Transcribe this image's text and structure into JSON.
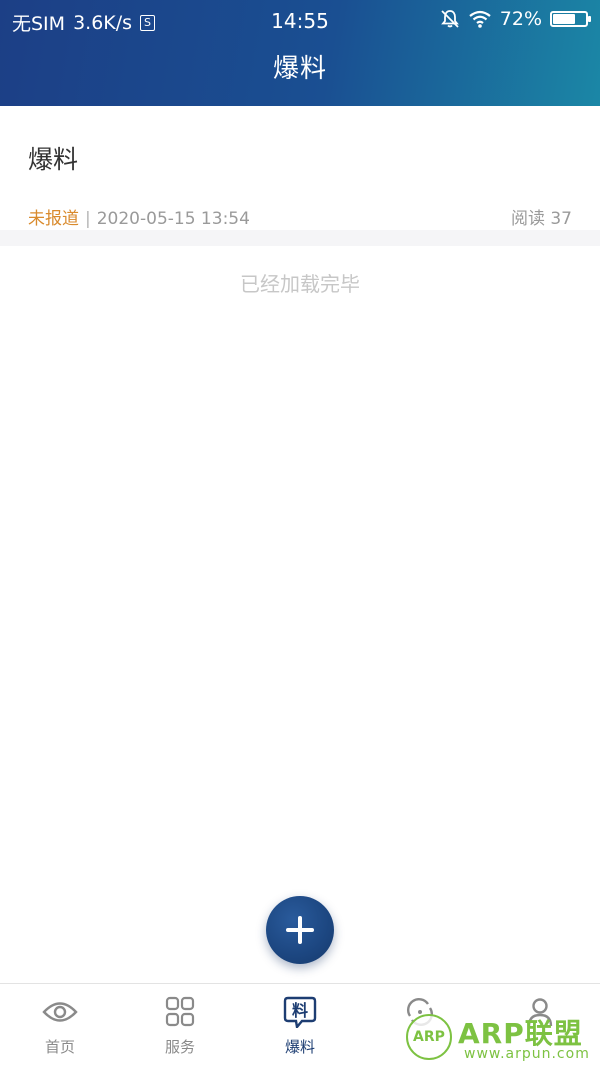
{
  "status_bar": {
    "carrier": "无SIM",
    "speed": "3.6K/s",
    "sim_badge": "S",
    "time": "14:55",
    "battery_percent_label": "72%",
    "battery_level": 0.72
  },
  "header": {
    "title": "爆料"
  },
  "feed": {
    "items": [
      {
        "title": "爆料",
        "status": "未报道",
        "separator": "|",
        "datetime": "2020-05-15 13:54",
        "reads": "阅读 37"
      }
    ],
    "end_message": "已经加载完毕"
  },
  "fab": {
    "icon": "plus-icon"
  },
  "bottom_nav": {
    "items": [
      {
        "label": "首页",
        "icon": "eye-icon",
        "active": false
      },
      {
        "label": "服务",
        "icon": "grid-icon",
        "active": false
      },
      {
        "label": "爆料",
        "icon": "tip-bubble-icon",
        "active": true
      },
      {
        "label": "",
        "icon": "sync-icon",
        "active": false
      },
      {
        "label": "",
        "icon": "user-icon",
        "active": false
      }
    ],
    "tip_icon_glyph": "料"
  },
  "watermark": {
    "badge": "ARP",
    "brand": "ARP联盟",
    "url": "www.arpun.com"
  },
  "colors": {
    "header_start": "#1c3f86",
    "header_end": "#1b87a6",
    "status_tag": "#d98a2c",
    "nav_active": "#1d3d72",
    "watermark": "#7dc242"
  }
}
